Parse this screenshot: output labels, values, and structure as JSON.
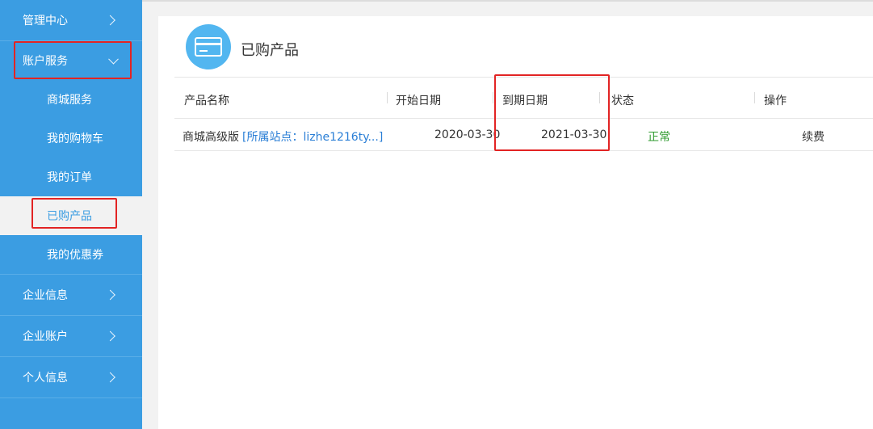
{
  "sidebar": {
    "items": [
      {
        "label": "管理中心"
      },
      {
        "label": "账户服务"
      },
      {
        "label": "商城服务"
      },
      {
        "label": "我的购物车"
      },
      {
        "label": "我的订单"
      },
      {
        "label": "已购产品"
      },
      {
        "label": "我的优惠券"
      },
      {
        "label": "企业信息"
      },
      {
        "label": "企业账户"
      },
      {
        "label": "个人信息"
      }
    ]
  },
  "main": {
    "title": "已购产品",
    "icon": "credit-card-icon",
    "table": {
      "headers": [
        "产品名称",
        "开始日期",
        "到期日期",
        "状态",
        "操作"
      ],
      "rows": [
        {
          "product": "商城高级版",
          "site_link": "[所属站点：lizhe1216ty...]",
          "start": "2020-03-30",
          "end": "2021-03-30",
          "status": "正常",
          "action": "续费"
        }
      ]
    }
  },
  "colors": {
    "sidebar_bg": "#3b9de2",
    "link": "#2b7fd6",
    "status_ok": "#2e9a2e",
    "highlight": "#e22424"
  }
}
